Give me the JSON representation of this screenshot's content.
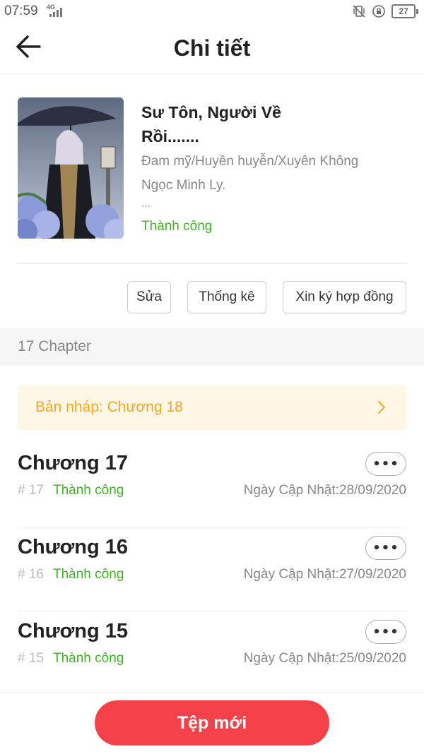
{
  "status_bar": {
    "time": "07:59",
    "network": "4G",
    "battery": "27"
  },
  "header": {
    "title": "Chi tiết"
  },
  "book": {
    "title": "Sư Tôn, Người Về Rồi.......",
    "genre": "Đam mỹ/Huyền huyễn/Xuyên Không",
    "author": "Ngọc Minh Ly.",
    "more": "...",
    "status": "Thành công"
  },
  "actions": {
    "edit": "Sửa",
    "stats": "Thống kê",
    "contract": "Xin ký hợp đồng"
  },
  "chapter_section": {
    "label": "17 Chapter"
  },
  "draft": {
    "label": "Bản nháp: Chương 18"
  },
  "chapters": [
    {
      "title": "Chương 17",
      "number": "# 17",
      "status": "Thành công",
      "date": "Ngày Cập Nhật:28/09/2020"
    },
    {
      "title": "Chương 16",
      "number": "# 16",
      "status": "Thành công",
      "date": "Ngày Cập Nhật:27/09/2020"
    },
    {
      "title": "Chương 15",
      "number": "# 15",
      "status": "Thành công",
      "date": "Ngày Cập Nhật:25/09/2020"
    }
  ],
  "more_label": "•••",
  "footer": {
    "new_button": "Tệp mới"
  },
  "icons": [
    "back-arrow-icon",
    "vibrate-icon",
    "lock-rotation-icon",
    "battery-icon",
    "chevron-right-icon"
  ],
  "colors": {
    "accent": "#f5424a",
    "success": "#43b02a",
    "draft": "#f5a623",
    "draft_bg": "#fff7e6"
  }
}
